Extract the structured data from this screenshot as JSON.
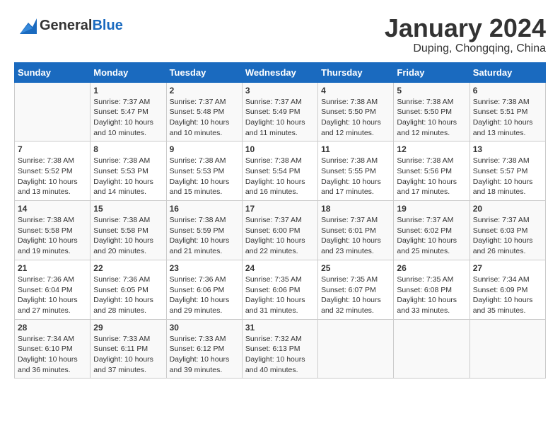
{
  "header": {
    "logo_general": "General",
    "logo_blue": "Blue",
    "title": "January 2024",
    "subtitle": "Duping, Chongqing, China"
  },
  "days_of_week": [
    "Sunday",
    "Monday",
    "Tuesday",
    "Wednesday",
    "Thursday",
    "Friday",
    "Saturday"
  ],
  "weeks": [
    [
      {
        "day": "",
        "info": ""
      },
      {
        "day": "1",
        "info": "Sunrise: 7:37 AM\nSunset: 5:47 PM\nDaylight: 10 hours\nand 10 minutes."
      },
      {
        "day": "2",
        "info": "Sunrise: 7:37 AM\nSunset: 5:48 PM\nDaylight: 10 hours\nand 10 minutes."
      },
      {
        "day": "3",
        "info": "Sunrise: 7:37 AM\nSunset: 5:49 PM\nDaylight: 10 hours\nand 11 minutes."
      },
      {
        "day": "4",
        "info": "Sunrise: 7:38 AM\nSunset: 5:50 PM\nDaylight: 10 hours\nand 12 minutes."
      },
      {
        "day": "5",
        "info": "Sunrise: 7:38 AM\nSunset: 5:50 PM\nDaylight: 10 hours\nand 12 minutes."
      },
      {
        "day": "6",
        "info": "Sunrise: 7:38 AM\nSunset: 5:51 PM\nDaylight: 10 hours\nand 13 minutes."
      }
    ],
    [
      {
        "day": "7",
        "info": "Sunrise: 7:38 AM\nSunset: 5:52 PM\nDaylight: 10 hours\nand 13 minutes."
      },
      {
        "day": "8",
        "info": "Sunrise: 7:38 AM\nSunset: 5:53 PM\nDaylight: 10 hours\nand 14 minutes."
      },
      {
        "day": "9",
        "info": "Sunrise: 7:38 AM\nSunset: 5:53 PM\nDaylight: 10 hours\nand 15 minutes."
      },
      {
        "day": "10",
        "info": "Sunrise: 7:38 AM\nSunset: 5:54 PM\nDaylight: 10 hours\nand 16 minutes."
      },
      {
        "day": "11",
        "info": "Sunrise: 7:38 AM\nSunset: 5:55 PM\nDaylight: 10 hours\nand 17 minutes."
      },
      {
        "day": "12",
        "info": "Sunrise: 7:38 AM\nSunset: 5:56 PM\nDaylight: 10 hours\nand 17 minutes."
      },
      {
        "day": "13",
        "info": "Sunrise: 7:38 AM\nSunset: 5:57 PM\nDaylight: 10 hours\nand 18 minutes."
      }
    ],
    [
      {
        "day": "14",
        "info": "Sunrise: 7:38 AM\nSunset: 5:58 PM\nDaylight: 10 hours\nand 19 minutes."
      },
      {
        "day": "15",
        "info": "Sunrise: 7:38 AM\nSunset: 5:58 PM\nDaylight: 10 hours\nand 20 minutes."
      },
      {
        "day": "16",
        "info": "Sunrise: 7:38 AM\nSunset: 5:59 PM\nDaylight: 10 hours\nand 21 minutes."
      },
      {
        "day": "17",
        "info": "Sunrise: 7:37 AM\nSunset: 6:00 PM\nDaylight: 10 hours\nand 22 minutes."
      },
      {
        "day": "18",
        "info": "Sunrise: 7:37 AM\nSunset: 6:01 PM\nDaylight: 10 hours\nand 23 minutes."
      },
      {
        "day": "19",
        "info": "Sunrise: 7:37 AM\nSunset: 6:02 PM\nDaylight: 10 hours\nand 25 minutes."
      },
      {
        "day": "20",
        "info": "Sunrise: 7:37 AM\nSunset: 6:03 PM\nDaylight: 10 hours\nand 26 minutes."
      }
    ],
    [
      {
        "day": "21",
        "info": "Sunrise: 7:36 AM\nSunset: 6:04 PM\nDaylight: 10 hours\nand 27 minutes."
      },
      {
        "day": "22",
        "info": "Sunrise: 7:36 AM\nSunset: 6:05 PM\nDaylight: 10 hours\nand 28 minutes."
      },
      {
        "day": "23",
        "info": "Sunrise: 7:36 AM\nSunset: 6:06 PM\nDaylight: 10 hours\nand 29 minutes."
      },
      {
        "day": "24",
        "info": "Sunrise: 7:35 AM\nSunset: 6:06 PM\nDaylight: 10 hours\nand 31 minutes."
      },
      {
        "day": "25",
        "info": "Sunrise: 7:35 AM\nSunset: 6:07 PM\nDaylight: 10 hours\nand 32 minutes."
      },
      {
        "day": "26",
        "info": "Sunrise: 7:35 AM\nSunset: 6:08 PM\nDaylight: 10 hours\nand 33 minutes."
      },
      {
        "day": "27",
        "info": "Sunrise: 7:34 AM\nSunset: 6:09 PM\nDaylight: 10 hours\nand 35 minutes."
      }
    ],
    [
      {
        "day": "28",
        "info": "Sunrise: 7:34 AM\nSunset: 6:10 PM\nDaylight: 10 hours\nand 36 minutes."
      },
      {
        "day": "29",
        "info": "Sunrise: 7:33 AM\nSunset: 6:11 PM\nDaylight: 10 hours\nand 37 minutes."
      },
      {
        "day": "30",
        "info": "Sunrise: 7:33 AM\nSunset: 6:12 PM\nDaylight: 10 hours\nand 39 minutes."
      },
      {
        "day": "31",
        "info": "Sunrise: 7:32 AM\nSunset: 6:13 PM\nDaylight: 10 hours\nand 40 minutes."
      },
      {
        "day": "",
        "info": ""
      },
      {
        "day": "",
        "info": ""
      },
      {
        "day": "",
        "info": ""
      }
    ]
  ]
}
